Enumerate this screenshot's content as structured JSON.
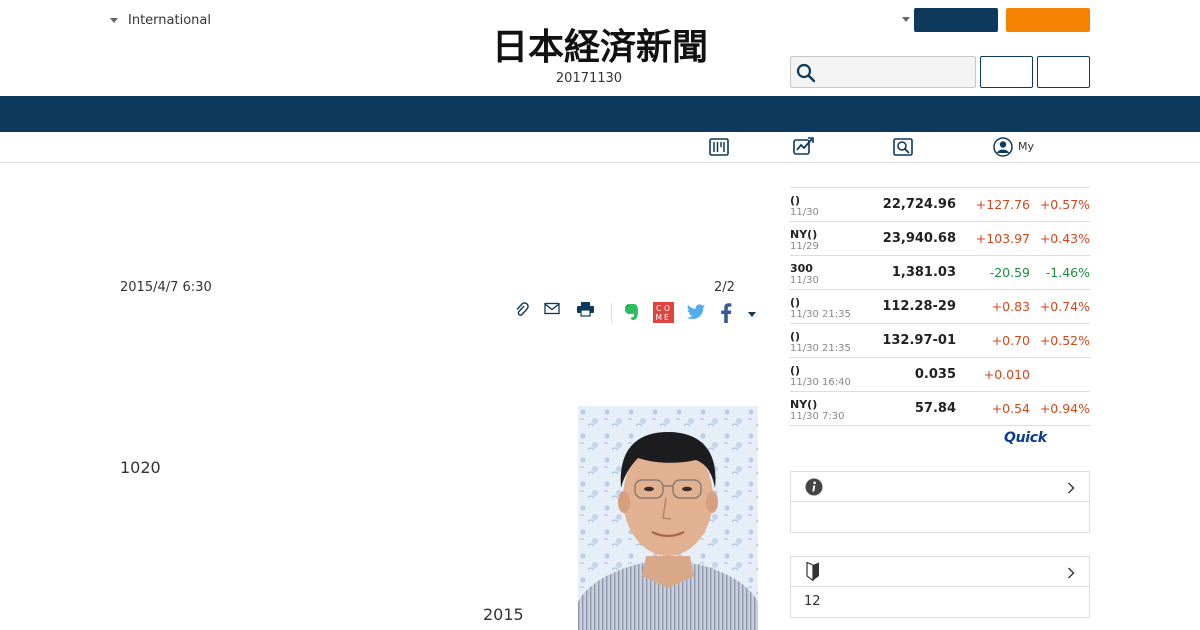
{
  "header": {
    "edition_label": "International",
    "logo_text": "日本経済新聞",
    "date": "20171130"
  },
  "search": {
    "placeholder": ""
  },
  "subnav": {
    "my_label": "My"
  },
  "article": {
    "date": "2015/4/7 6:30",
    "page": "2/2",
    "text_1": "1020",
    "text_2": "2015"
  },
  "market": {
    "rows": [
      {
        "name": "()",
        "date": "11/30",
        "value": "22,724.96",
        "change": "+127.76",
        "pct": "+0.57%"
      },
      {
        "name": "NY()",
        "date": "11/29",
        "value": "23,940.68",
        "change": "+103.97",
        "pct": "+0.43%"
      },
      {
        "name": "300",
        "date": "11/30",
        "value": "1,381.03",
        "change": "-20.59",
        "pct": "-1.46%"
      },
      {
        "name": "()",
        "date": "11/30 21:35",
        "value": "112.28-29",
        "change": "+0.83",
        "pct": "+0.74%"
      },
      {
        "name": "()",
        "date": "11/30 21:35",
        "value": "132.97-01",
        "change": "+0.70",
        "pct": "+0.52%"
      },
      {
        "name": "()",
        "date": "11/30 16:40",
        "value": "0.035",
        "change": "+0.010",
        "pct": ""
      },
      {
        "name": "NY()",
        "date": "11/30 7:30",
        "value": "57.84",
        "change": "+0.54",
        "pct": "+0.94%"
      }
    ],
    "source_logo": "Quick"
  },
  "sidebox2": {
    "count": "12"
  },
  "colors": {
    "navy": "#0d3a5c",
    "orange": "#f58200",
    "up": "#d2471c",
    "down": "#1a8f3c"
  }
}
